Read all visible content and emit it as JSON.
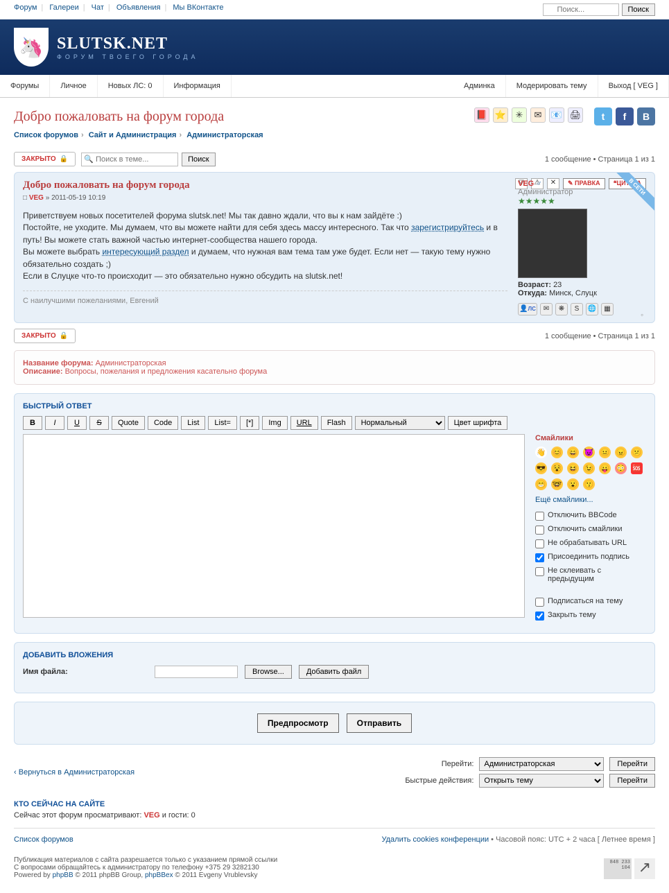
{
  "topbar": {
    "links": [
      "Форум",
      "Галереи",
      "Чат",
      "Объявления",
      "Мы ВКонтакте"
    ],
    "search_placeholder": "Поиск...",
    "search_btn": "Поиск"
  },
  "header": {
    "site_name": "SLUTSK.NET",
    "tagline": "ФОРУМ ТВОЕГО ГОРОДА"
  },
  "nav": {
    "left": [
      "Форумы",
      "Личное",
      "Новых ЛС: 0",
      "Информация"
    ],
    "right": [
      "Админка",
      "Модерировать тему",
      "Выход [ VEG ]"
    ]
  },
  "page_title": "Добро пожаловать на форум города",
  "breadcrumb": {
    "a": "Список форумов",
    "b": "Сайт и Администрация",
    "c": "Администраторская"
  },
  "topic_actions": {
    "locked": "ЗАКРЫТО",
    "search_placeholder": "Поиск в теме...",
    "search_btn": "Поиск",
    "pagination": "1 сообщение • Страница 1 из 1"
  },
  "post": {
    "title": "Добро пожаловать на форум города",
    "author": "VEG",
    "date": "» 2011-05-19 10:19",
    "p1": "Приветствуем новых посетителей форума slutsk.net! Мы так давно ждали, что вы к нам зайдёте :)",
    "p2a": "Постойте, не уходите. Мы думаем, что вы можете найти для себя здесь массу интересного. Так что ",
    "link1": "зарегистрируйтесь",
    "p2b": " и в путь! Вы можете стать важной частью интернет-сообщества нашего города.",
    "p3a": "Вы можете выбрать ",
    "link2": "интересующий раздел",
    "p3b": " и думаем, что нужная вам тема там уже будет. Если нет — такую тему нужно обязательно создать ;)",
    "p4": "Если в Слуцке что-то происходит — это обязательно нужно обсудить на slutsk.net!",
    "sig": "С наилучшими пожеланиями, Евгений",
    "edit_btn": "ПРАВКА",
    "quote_btn": "ЦИТАТА"
  },
  "profile": {
    "name": "VEG",
    "rank": "Администратор",
    "age_label": "Возраст:",
    "age": "23",
    "from_label": "Откуда:",
    "from": "Минск, Слуцк",
    "online": "В СЕТИ",
    "pm_label": "ЛС"
  },
  "forum_desc": {
    "name_lbl": "Название форума:",
    "name": "Администраторская",
    "desc_lbl": "Описание:",
    "desc": "Вопросы, пожелания и предложения касательно форума"
  },
  "reply": {
    "title": "БЫСТРЫЙ ОТВЕТ",
    "bbcode": [
      "B",
      "I",
      "U",
      "S",
      "Quote",
      "Code",
      "List",
      "List=",
      "[*]",
      "Img",
      "URL",
      "Flash"
    ],
    "font_size": "Нормальный",
    "font_color": "Цвет шрифта",
    "smileys_title": "Смайлики",
    "more_smileys": "Ещё смайлики...",
    "checks": {
      "disable_bbcode": "Отключить BBCode",
      "disable_smileys": "Отключить смайлики",
      "no_url": "Не обрабатывать URL",
      "attach_sig": "Присоединить подпись",
      "no_merge": "Не склеивать с предыдущим",
      "subscribe": "Подписаться на тему",
      "lock": "Закрыть тему"
    }
  },
  "attach": {
    "title": "ДОБАВИТЬ ВЛОЖЕНИЯ",
    "file_label": "Имя файла:",
    "browse": "Browse...",
    "add": "Добавить файл"
  },
  "submit": {
    "preview": "Предпросмотр",
    "submit": "Отправить"
  },
  "bottom": {
    "return": "Вернуться в Администраторская",
    "jump_label": "Перейти:",
    "jump_value": "Администраторская",
    "go": "Перейти",
    "quick_label": "Быстрые действия:",
    "quick_value": "Открыть тему"
  },
  "online": {
    "title": "КТО СЕЙЧАС НА САЙТЕ",
    "text_a": "Сейчас этот форум просматривают: ",
    "user": "VEG",
    "text_b": " и гости: 0"
  },
  "footer": {
    "index": "Список форумов",
    "cookies": "Удалить cookies конференции",
    "tz": "• Часовой пояс: UTC + 2 часа [ Летнее время ]",
    "c1": "Публикация материалов с сайта разрешается только с указанием прямой ссылки",
    "c2": "С вопросами обращайтесь к администратору по телефону +375 29 3282130",
    "c3a": "Powered by ",
    "phpbb": "phpBB",
    "c3b": " © 2011 phpBB Group, ",
    "phpbbex": "phpBBex",
    "c3c": " © 2011 Evgeny Vrublevsky",
    "counter": "848\n233\n104"
  }
}
